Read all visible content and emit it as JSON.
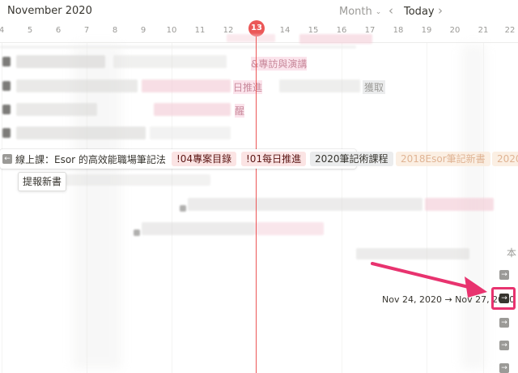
{
  "header": {
    "title": "November 2020",
    "view_label": "Month",
    "view_caret": "⌄",
    "prev_icon": "‹",
    "today_label": "Today",
    "next_icon": "›"
  },
  "days": [
    "4",
    "5",
    "6",
    "7",
    "8",
    "9",
    "10",
    "11",
    "12",
    "13",
    "14",
    "15",
    "16",
    "17",
    "18",
    "19",
    "20",
    "21",
    "22"
  ],
  "today": "13",
  "focused_row": {
    "arrow": "←",
    "title": "線上課：Esor 的高效能職場筆記法",
    "tags": [
      "!04專案目錄",
      "!01每日推進",
      "2020筆記術課程",
      "2018Esor筆記新書",
      "2020"
    ]
  },
  "tooltip": "提報新書",
  "ghost_texts": [
    "&專訪與演講",
    "日推進",
    "醒",
    "獲取"
  ],
  "right_text": "本",
  "date_range": "Nov 24, 2020 → Nov 27, 2020",
  "row_arrow_icon": "→",
  "colors": {
    "accent_red": "#eb5757",
    "highlight_pink": "#e8336f"
  }
}
